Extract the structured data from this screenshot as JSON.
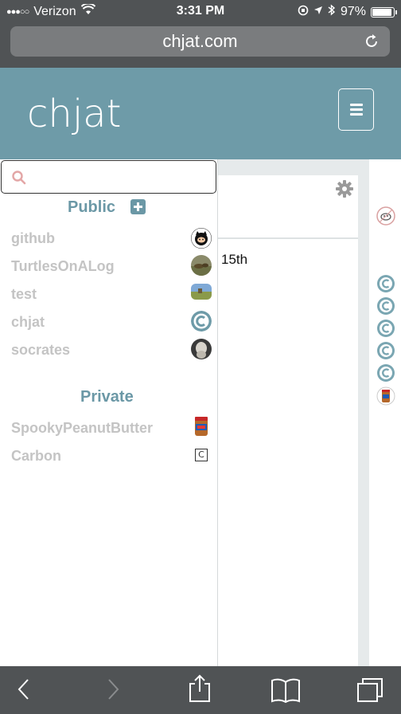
{
  "status_bar": {
    "signal": "●●●○○",
    "carrier": "Verizon",
    "time": "3:31 PM",
    "battery": "97%",
    "battery_level": 0.97
  },
  "browser": {
    "url": "chjat.com"
  },
  "header": {
    "brand": "chjat"
  },
  "sidebar": {
    "public_title": "Public",
    "private_title": "Private",
    "public_rooms": [
      {
        "name": "github",
        "icon": "github-octocat-avatar"
      },
      {
        "name": "TurtlesOnALog",
        "icon": "turtle-photo-avatar"
      },
      {
        "name": "test",
        "icon": "landscape-photo-avatar"
      },
      {
        "name": "chjat",
        "icon": "chjat-logo-avatar"
      },
      {
        "name": "socrates",
        "icon": "socrates-bust-avatar"
      }
    ],
    "private_rooms": [
      {
        "name": "SpookyPeanutButter",
        "icon": "peanut-butter-jar-avatar"
      },
      {
        "name": "Carbon",
        "icon": "carbon-element-avatar"
      }
    ],
    "carbon_symbol": "C"
  },
  "chat": {
    "date_fragment": "15th"
  },
  "colors": {
    "header": "#6e9ba8",
    "accent": "#6b98a6",
    "browser_chrome": "#505355",
    "room_text": "#c4c4c4"
  }
}
